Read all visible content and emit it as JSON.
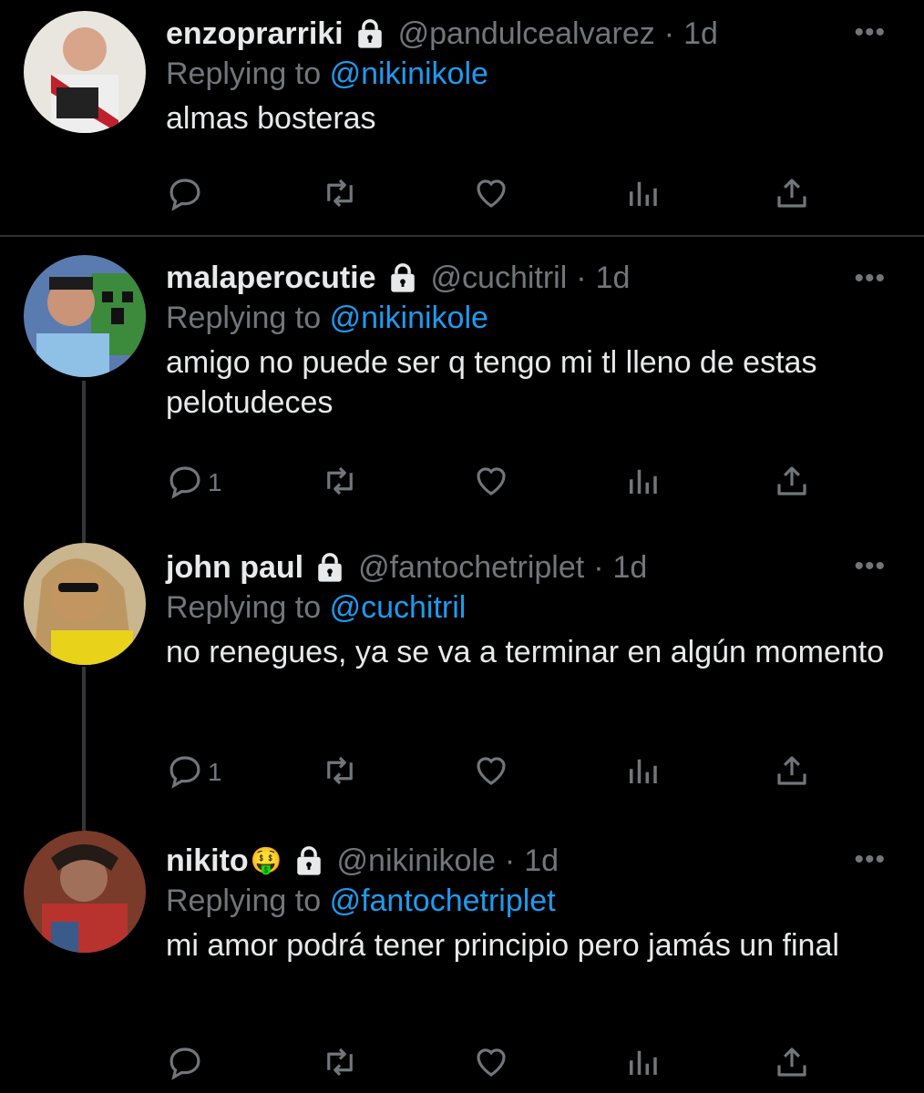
{
  "tweets": [
    {
      "name": "enzoprarriki",
      "emoji": "",
      "handle": "@pandulcealvarez",
      "time": "1d",
      "replying_prefix": "Replying to",
      "replying_to": "@nikinikole",
      "text": "almas bosteras",
      "reply_count": ""
    },
    {
      "name": "malaperocutie",
      "emoji": "",
      "handle": "@cuchitril",
      "time": "1d",
      "replying_prefix": "Replying to",
      "replying_to": "@nikinikole",
      "text": "amigo no puede ser q tengo mi tl lleno de estas pelotudeces",
      "reply_count": "1"
    },
    {
      "name": "john paul",
      "emoji": "",
      "handle": "@fantochetriplet",
      "time": "1d",
      "replying_prefix": "Replying to",
      "replying_to": "@cuchitril",
      "text": "no renegues, ya se va a terminar en algún momento",
      "reply_count": "1"
    },
    {
      "name": "nikito",
      "emoji": "🤑",
      "handle": "@nikinikole",
      "time": "1d",
      "replying_prefix": "Replying to",
      "replying_to": "@fantochetriplet",
      "text": "mi amor podrá tener principio pero jamás un final",
      "reply_count": ""
    }
  ],
  "more_label": "•••",
  "separator": "·",
  "colors": {
    "background": "#000000",
    "text": "#e7e9ea",
    "muted": "#71767b",
    "link": "#1d9bf0",
    "line": "#333639"
  },
  "icons": [
    "reply-icon",
    "retweet-icon",
    "like-icon",
    "analytics-icon",
    "share-icon",
    "lock-icon",
    "more-icon"
  ]
}
